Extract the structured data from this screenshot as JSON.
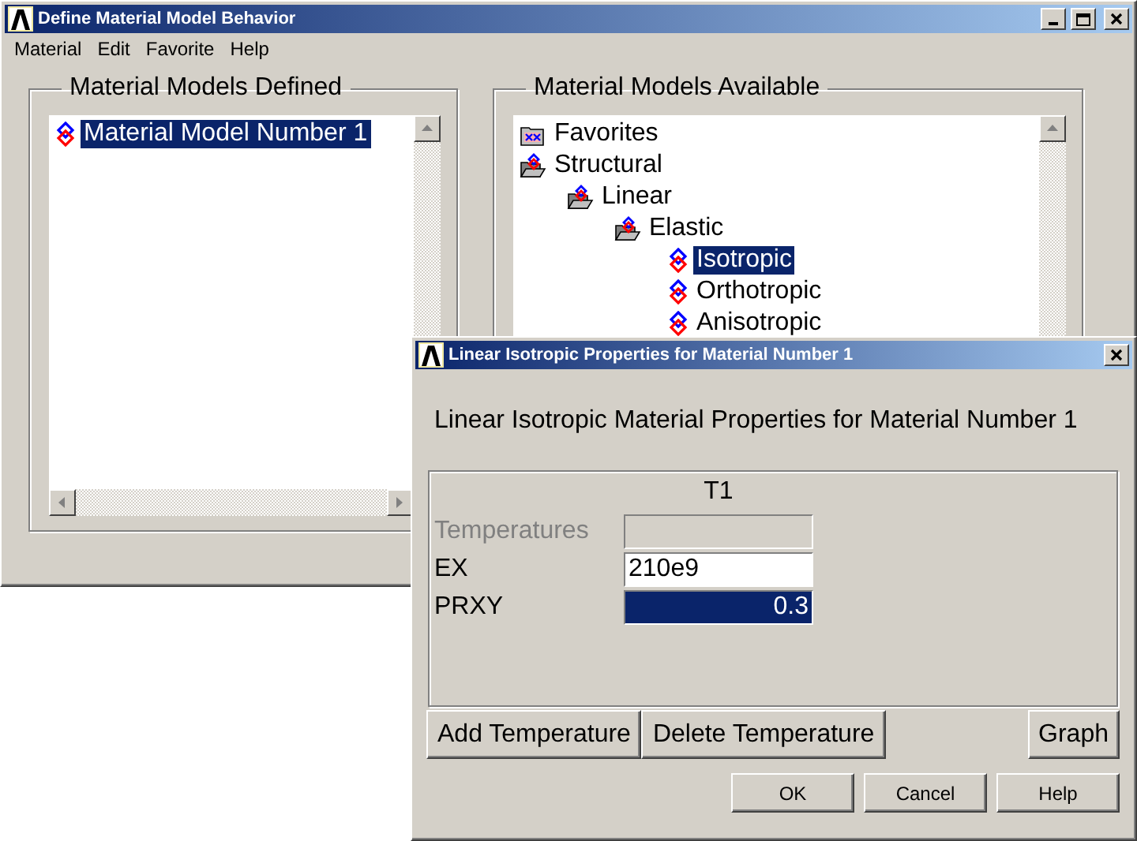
{
  "main_window": {
    "title": "Define Material Model Behavior",
    "menu": [
      "Material",
      "Edit",
      "Favorite",
      "Help"
    ],
    "defined_panel": {
      "title": "Material Models Defined",
      "items": [
        {
          "label": "Material Model Number 1",
          "selected": true
        }
      ]
    },
    "available_panel": {
      "title": "Material Models Available",
      "tree": [
        {
          "label": "Favorites",
          "kind": "folder",
          "expanded": false,
          "selected": false
        },
        {
          "label": "Structural",
          "kind": "folder",
          "expanded": true,
          "selected": false,
          "children": [
            {
              "label": "Linear",
              "kind": "folder",
              "expanded": true,
              "selected": false,
              "children": [
                {
                  "label": "Elastic",
                  "kind": "folder",
                  "expanded": true,
                  "selected": false,
                  "children": [
                    {
                      "label": "Isotropic",
                      "kind": "model",
                      "selected": true
                    },
                    {
                      "label": "Orthotropic",
                      "kind": "model",
                      "selected": false
                    },
                    {
                      "label": "Anisotropic",
                      "kind": "model",
                      "selected": false
                    }
                  ]
                }
              ]
            }
          ]
        }
      ]
    }
  },
  "dialog": {
    "title": "Linear Isotropic Properties for Material Number 1",
    "heading": "Linear Isotropic Material Properties for Material Number 1",
    "column": "T1",
    "rows": [
      {
        "label": "Temperatures",
        "disabled": true,
        "selected": false
      },
      {
        "label": "EX",
        "value": "210e9",
        "disabled": false,
        "selected": false
      },
      {
        "label": "PRXY",
        "value": "0.3",
        "disabled": false,
        "selected": true
      }
    ],
    "table_buttons": [
      "Add Temperature",
      "Delete Temperature"
    ],
    "graph_button": "Graph",
    "footer_buttons": [
      "OK",
      "Cancel",
      "Help"
    ]
  }
}
